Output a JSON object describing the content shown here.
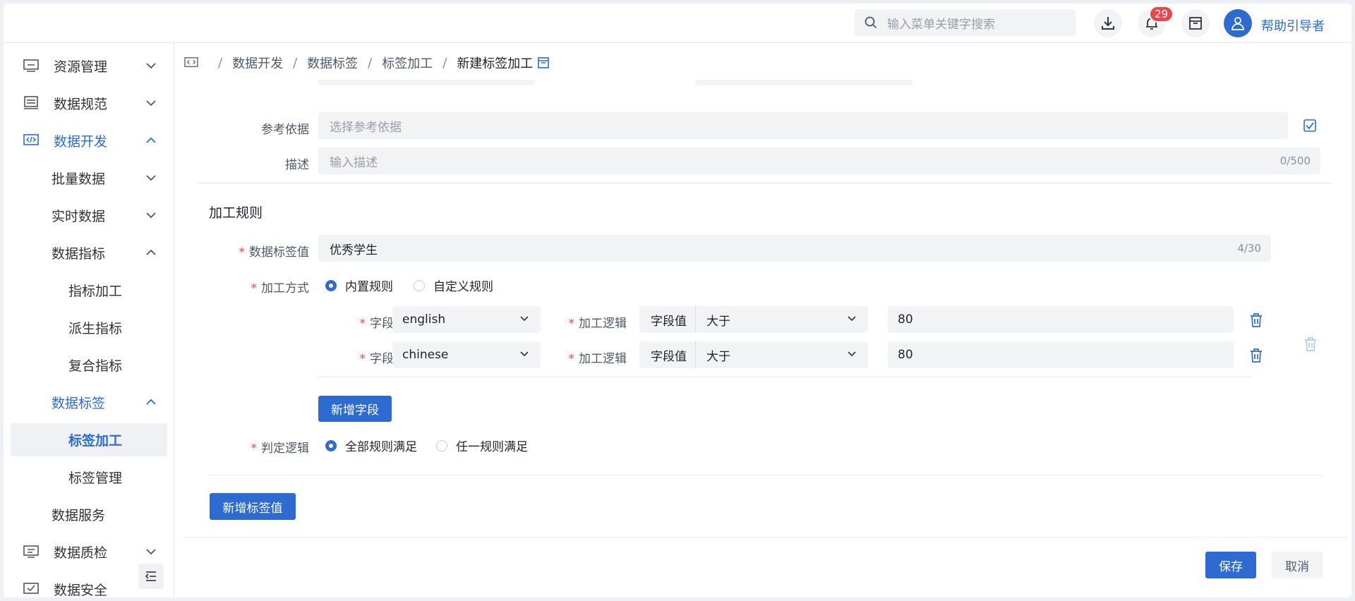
{
  "header": {
    "search_placeholder": "输入菜单关键字搜索",
    "notification_count": "29",
    "username": "帮助引导者"
  },
  "sidebar": {
    "items": [
      {
        "label": "资源管理"
      },
      {
        "label": "数据规范"
      },
      {
        "label": "数据开发"
      },
      {
        "label": "批量数据"
      },
      {
        "label": "实时数据"
      },
      {
        "label": "数据指标"
      },
      {
        "label": "指标加工"
      },
      {
        "label": "派生指标"
      },
      {
        "label": "复合指标"
      },
      {
        "label": "数据标签"
      },
      {
        "label": "标签加工"
      },
      {
        "label": "标签管理"
      },
      {
        "label": "数据服务"
      },
      {
        "label": "数据质检"
      },
      {
        "label": "数据安全"
      }
    ]
  },
  "breadcrumb": {
    "items": [
      "数据开发",
      "数据标签",
      "标签加工"
    ],
    "current": "新建标签加工"
  },
  "form": {
    "reference_label": "参考依据",
    "reference_placeholder": "选择参考依据",
    "description_label": "描述",
    "description_placeholder": "输入描述",
    "description_count": "0/500",
    "section_title": "加工规则",
    "tag_value_label": "数据标签值",
    "tag_value": "优秀学生",
    "tag_value_count": "4/30",
    "method_label": "加工方式",
    "method_options": [
      "内置规则",
      "自定义规则"
    ],
    "method_selected": "内置规则",
    "rules": [
      {
        "field_label": "字段",
        "field": "english",
        "logic_label": "加工逻辑",
        "logic_type": "字段值",
        "operator": "大于",
        "value": "80"
      },
      {
        "field_label": "字段",
        "field": "chinese",
        "logic_label": "加工逻辑",
        "logic_type": "字段值",
        "operator": "大于",
        "value": "80"
      }
    ],
    "add_field_button": "新增字段",
    "judge_label": "判定逻辑",
    "judge_options": [
      "全部规则满足",
      "任一规则满足"
    ],
    "judge_selected": "全部规则满足",
    "add_tag_value_button": "新增标签值"
  },
  "footer": {
    "save": "保存",
    "cancel": "取消"
  },
  "colors": {
    "primary": "#2d6bd1",
    "danger": "#e5484d",
    "field_bg": "#f2f3f5"
  }
}
